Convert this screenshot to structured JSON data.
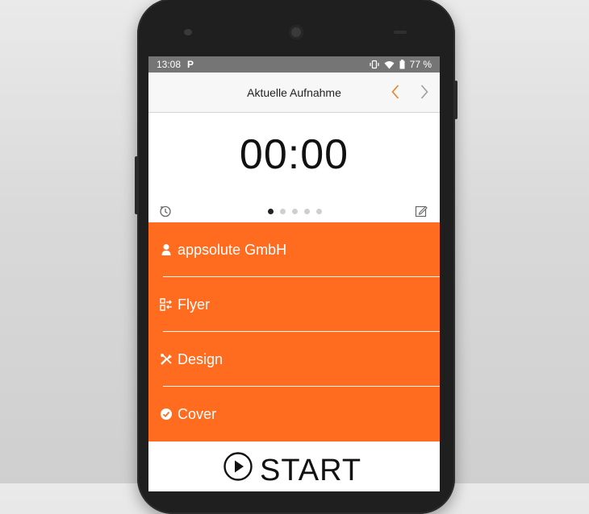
{
  "status": {
    "time": "13:08",
    "app_indicator": "P",
    "battery": "77 %",
    "icons": [
      "vibrate-icon",
      "wifi-icon",
      "battery-icon"
    ]
  },
  "header": {
    "title": "Aktuelle Aufnahme",
    "prev_icon": "chevron-left-icon",
    "next_icon": "chevron-right-icon"
  },
  "timer": {
    "value": "00:00",
    "pager_total": 5,
    "pager_active": 1
  },
  "items": [
    {
      "label": "appsolute GmbH",
      "icon": "person-icon"
    },
    {
      "label": "Flyer",
      "icon": "project-icon"
    },
    {
      "label": "Design",
      "icon": "tools-icon"
    },
    {
      "label": "Cover",
      "icon": "check-circle-icon"
    }
  ],
  "start": {
    "label": "START",
    "icon": "play-circle-icon"
  },
  "colors": {
    "accent": "#ff6b1f",
    "prev_arrow": "#e8832a",
    "next_arrow": "#9e9e9e",
    "statusbar": "#757575"
  }
}
